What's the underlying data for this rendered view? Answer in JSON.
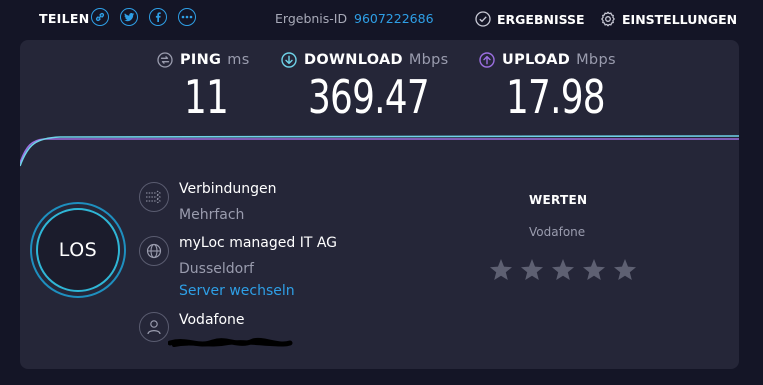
{
  "header": {
    "share_label": "TEILEN",
    "share_icons": [
      "link-icon",
      "twitter-icon",
      "facebook-icon",
      "more-icon"
    ],
    "result_label": "Ergebnis-ID",
    "result_id": "9607222686",
    "results_label": "ERGEBNISSE",
    "settings_label": "EINSTELLUNGEN"
  },
  "metrics": {
    "ping": {
      "label": "PING",
      "unit": "ms",
      "value": "11"
    },
    "download": {
      "label": "DOWNLOAD",
      "unit": "Mbps",
      "value": "369.47"
    },
    "upload": {
      "label": "UPLOAD",
      "unit": "Mbps",
      "value": "17.98"
    }
  },
  "go_button": {
    "label": "LOS"
  },
  "connections": {
    "title": "Verbindungen",
    "value": "Mehrfach"
  },
  "server": {
    "name": "myLoc managed IT AG",
    "location": "Dusseldorf",
    "change_link": "Server wechseln"
  },
  "provider": {
    "name": "Vodafone"
  },
  "rating": {
    "title": "WERTEN",
    "isp": "Vodafone",
    "stars_total": 5,
    "stars_selected": 0
  },
  "colors": {
    "accent_blue": "#2e9fe6",
    "download_line": "#6fd3e8",
    "upload_line": "#9b6fe0",
    "panel_bg": "#252638",
    "page_bg": "#141526"
  }
}
